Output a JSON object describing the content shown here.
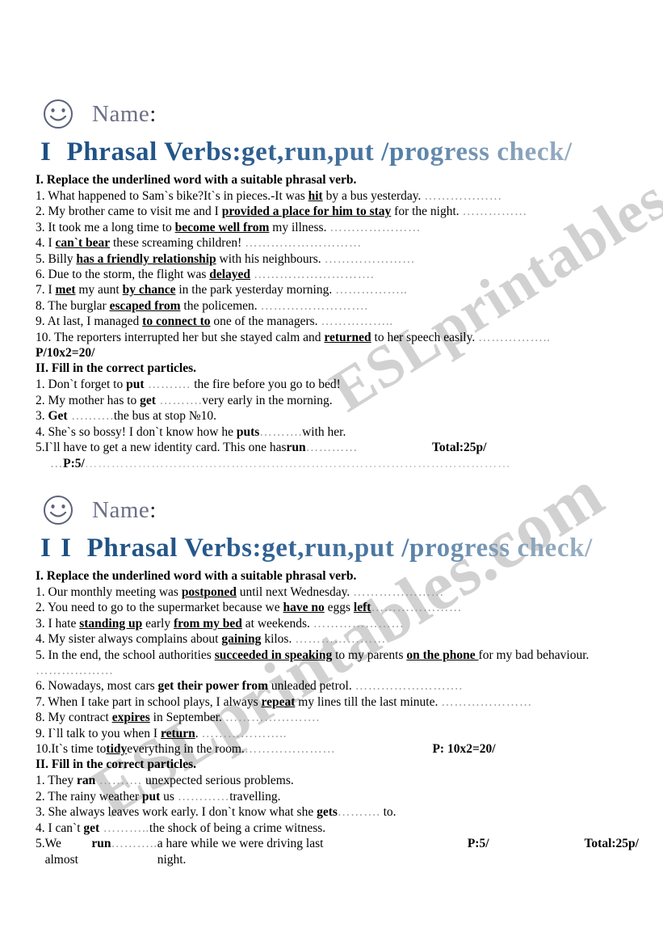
{
  "watermark": {
    "text_a": "ESLprintables.com",
    "text_b": "ESLprintables.com"
  },
  "worksheets": [
    {
      "name_label": "Name",
      "colon": ":",
      "title_roman": "I",
      "title_main": "Phrasal Verbs:get,run,put /progress check/",
      "section1": {
        "heading": "I.  Replace the underlined word with a suitable phrasal verb.",
        "items": [
          {
            "n": "1.",
            "parts": [
              {
                "t": "What happened to Sam`s bike?It`s in pieces.-It was ",
                "s": "p"
              },
              {
                "t": "hit",
                "s": "u"
              },
              {
                "t": " by a bus yesterday. ",
                "s": "p"
              },
              {
                "t": "………………",
                "s": "d"
              }
            ]
          },
          {
            "n": "2.",
            "parts": [
              {
                "t": "My brother came to visit me and I ",
                "s": "p"
              },
              {
                "t": "provided a place for him to stay",
                "s": "u"
              },
              {
                "t": " for the night. ",
                "s": "p"
              },
              {
                "t": "……………",
                "s": "d"
              }
            ]
          },
          {
            "n": "3.",
            "parts": [
              {
                "t": "It took me a long time to ",
                "s": "p"
              },
              {
                "t": "become well from",
                "s": "u"
              },
              {
                "t": " my illness. ",
                "s": "p"
              },
              {
                "t": "…………………",
                "s": "d"
              }
            ]
          },
          {
            "n": "4.",
            "parts": [
              {
                "t": "I ",
                "s": "p"
              },
              {
                "t": "can`t bear",
                "s": "u"
              },
              {
                "t": " these screaming children! ",
                "s": "p"
              },
              {
                "t": "………………………",
                "s": "d"
              }
            ]
          },
          {
            "n": "5.",
            "parts": [
              {
                "t": "Billy ",
                "s": "p"
              },
              {
                "t": "has a friendly relationship",
                "s": "u"
              },
              {
                "t": " with his neighbours. ",
                "s": "p"
              },
              {
                "t": "…………………",
                "s": "d"
              }
            ]
          },
          {
            "n": "6.",
            "parts": [
              {
                "t": "Due to the storm, the flight was ",
                "s": "p"
              },
              {
                "t": "delayed",
                "s": "u"
              },
              {
                "t": " ",
                "s": "p"
              },
              {
                "t": "……………………….",
                "s": "d"
              }
            ]
          },
          {
            "n": "7.",
            "parts": [
              {
                "t": "I ",
                "s": "p"
              },
              {
                "t": "met",
                "s": "u"
              },
              {
                "t": " my aunt ",
                "s": "p"
              },
              {
                "t": "by chance",
                "s": "u"
              },
              {
                "t": " in the park yesterday morning. ",
                "s": "p"
              },
              {
                "t": "……………..",
                "s": "d"
              }
            ]
          },
          {
            "n": "8.",
            "parts": [
              {
                "t": "The burglar ",
                "s": "p"
              },
              {
                "t": "escaped from",
                "s": "u"
              },
              {
                "t": " the policemen. ",
                "s": "p"
              },
              {
                "t": "…………………….",
                "s": "d"
              }
            ]
          },
          {
            "n": "9.",
            "parts": [
              {
                "t": "At last, I managed ",
                "s": "p"
              },
              {
                "t": "to connect to",
                "s": "u"
              },
              {
                "t": " one of the managers. ",
                "s": "p"
              },
              {
                "t": "……………..",
                "s": "d"
              }
            ]
          },
          {
            "n": "10.",
            "parts": [
              {
                "t": "The reporters interrupted her but she stayed calm and ",
                "s": "p"
              },
              {
                "t": "returned",
                "s": "u"
              },
              {
                "t": " to her speech easily. ",
                "s": "p"
              },
              {
                "t": "……………..",
                "s": "d"
              }
            ]
          }
        ],
        "score": "P/10x2=20/"
      },
      "section2": {
        "heading": "II. Fill in the correct particles.",
        "items": [
          {
            "n": "1.",
            "parts": [
              {
                "t": "Don`t forget to ",
                "s": "p"
              },
              {
                "t": "put",
                "s": "b"
              },
              {
                "t": " ………. ",
                "s": "d"
              },
              {
                "t": "the fire before you go to bed!",
                "s": "p"
              }
            ]
          },
          {
            "n": "2.",
            "parts": [
              {
                "t": "My mother has to ",
                "s": "p"
              },
              {
                "t": "get",
                "s": "b"
              },
              {
                "t": " ……….",
                "s": "d"
              },
              {
                "t": "very early in the morning.",
                "s": "p"
              }
            ]
          },
          {
            "n": "3.",
            "parts": [
              {
                "t": "",
                "s": "p"
              },
              {
                "t": "Get",
                "s": "b"
              },
              {
                "t": " ……….",
                "s": "d"
              },
              {
                "t": "the bus at stop №10.",
                "s": "p"
              }
            ]
          },
          {
            "n": "4.",
            "parts": [
              {
                "t": "She`s  so bossy! I don`t know how he ",
                "s": "p"
              },
              {
                "t": "puts",
                "s": "b"
              },
              {
                "t": "……….",
                "s": "d"
              },
              {
                "t": "with her.",
                "s": "p"
              }
            ]
          }
        ],
        "last_item": {
          "n": "5.",
          "text_before": "I`ll have to get a new identity card. This one has ",
          "verb": "run",
          "dots": "…………",
          "total": "Total:25p/"
        },
        "p_line": {
          "lead": "…",
          "label": "P:5/",
          "trail": "……………………………………………………………………………………"
        }
      }
    },
    {
      "name_label": "Name",
      "colon": ":",
      "title_roman": "I I",
      "title_main": "Phrasal Verbs:get,run,put /progress check/",
      "section1": {
        "heading": "I.  Replace the underlined word with a suitable phrasal verb.",
        "items": [
          {
            "n": "1.",
            "parts": [
              {
                "t": "Our monthly meeting was ",
                "s": "p"
              },
              {
                "t": "postponed",
                "s": "u"
              },
              {
                "t": " until next Wednesday. ",
                "s": "p"
              },
              {
                "t": "…………………",
                "s": "d"
              }
            ]
          },
          {
            "n": "2.",
            "parts": [
              {
                "t": "You need to go to the supermarket because we ",
                "s": "p"
              },
              {
                "t": "have no",
                "s": "u"
              },
              {
                "t": " eggs ",
                "s": "p"
              },
              {
                "t": "left",
                "s": "u"
              },
              {
                "t": "…………………",
                "s": "d"
              }
            ]
          },
          {
            "n": "3.",
            "parts": [
              {
                "t": "I hate ",
                "s": "p"
              },
              {
                "t": "standing up",
                "s": "u"
              },
              {
                "t": " early ",
                "s": "p"
              },
              {
                "t": "from my bed",
                "s": "u"
              },
              {
                "t": " at weekends. ",
                "s": "p"
              },
              {
                "t": "…………………",
                "s": "d"
              }
            ]
          },
          {
            "n": "4.",
            "parts": [
              {
                "t": "My sister always complains about ",
                "s": "p"
              },
              {
                "t": "gaining",
                "s": "u"
              },
              {
                "t": " kilos. ",
                "s": "p"
              },
              {
                "t": "…………………",
                "s": "d"
              }
            ]
          },
          {
            "n": "5.",
            "parts": [
              {
                "t": "In the end, the school authorities ",
                "s": "p"
              },
              {
                "t": "succeeded in speaking",
                "s": "u"
              },
              {
                "t": " to my parents ",
                "s": "p"
              },
              {
                "t": "on the phone ",
                "s": "u"
              },
              {
                "t": "for my bad behaviour.",
                "s": "p"
              }
            ],
            "cont": "………………"
          },
          {
            "n": "6.",
            "parts": [
              {
                "t": "Nowadays, most cars ",
                "s": "p"
              },
              {
                "t": "get their power from",
                "s": "b"
              },
              {
                "t": " unleaded   petrol. ",
                "s": "p"
              },
              {
                "t": "…………………….",
                "s": "d"
              }
            ]
          },
          {
            "n": "7.",
            "parts": [
              {
                "t": "When I take part in school plays, I always ",
                "s": "p"
              },
              {
                "t": "repeat",
                "s": "u"
              },
              {
                "t": " my lines till the last minute. ",
                "s": "p"
              },
              {
                "t": "…………………",
                "s": "d"
              }
            ]
          },
          {
            "n": "8.",
            "parts": [
              {
                "t": "My contract ",
                "s": "p"
              },
              {
                "t": "expires",
                "s": "u"
              },
              {
                "t": " in September. ",
                "s": "p"
              },
              {
                "t": "………………….",
                "s": "d"
              }
            ]
          },
          {
            "n": "9.",
            "parts": [
              {
                "t": "I`ll talk to you when I ",
                "s": "p"
              },
              {
                "t": "return",
                "s": "u"
              },
              {
                "t": ". ",
                "s": "p"
              },
              {
                "t": "………………..",
                "s": "d"
              }
            ]
          }
        ],
        "last_item": {
          "n": "10.",
          "text_before": "It`s time to ",
          "verb": "tidy",
          "text_after": " everything in the room. ",
          "dots": "…………………",
          "score": "P: 10x2=20/"
        }
      },
      "section2": {
        "heading": "II. Fill in the correct particles.",
        "items": [
          {
            "n": "1.",
            "parts": [
              {
                "t": "They ",
                "s": "p"
              },
              {
                "t": "ran",
                "s": "b"
              },
              {
                "t": " ………. ",
                "s": "d"
              },
              {
                "t": "unexpected serious problems.",
                "s": "p"
              }
            ]
          },
          {
            "n": "2.",
            "parts": [
              {
                "t": "The rainy weather ",
                "s": "p"
              },
              {
                "t": "put",
                "s": "b"
              },
              {
                "t": " us ",
                "s": "p"
              },
              {
                "t": "…………",
                "s": "d"
              },
              {
                "t": "travelling.",
                "s": "p"
              }
            ]
          },
          {
            "n": "3.",
            "parts": [
              {
                "t": "She always leaves work early. I don`t know what she ",
                "s": "p"
              },
              {
                "t": "gets",
                "s": "b"
              },
              {
                "t": "……….",
                "s": "d"
              },
              {
                "t": " to.",
                "s": "p"
              }
            ]
          },
          {
            "n": "4.",
            "parts": [
              {
                "t": "I can`t ",
                "s": "p"
              },
              {
                "t": "get",
                "s": "b"
              },
              {
                "t": " ………..",
                "s": "d"
              },
              {
                "t": "the shock of being a crime witness.",
                "s": "p"
              }
            ]
          }
        ],
        "last_item": {
          "n": "5.",
          "text_before": "We almost ",
          "verb": "run",
          "dots": "………..",
          "text_after": "a hare while we were driving last night.",
          "p_label": "P:5/",
          "total": "Total:25p/"
        }
      }
    }
  ]
}
